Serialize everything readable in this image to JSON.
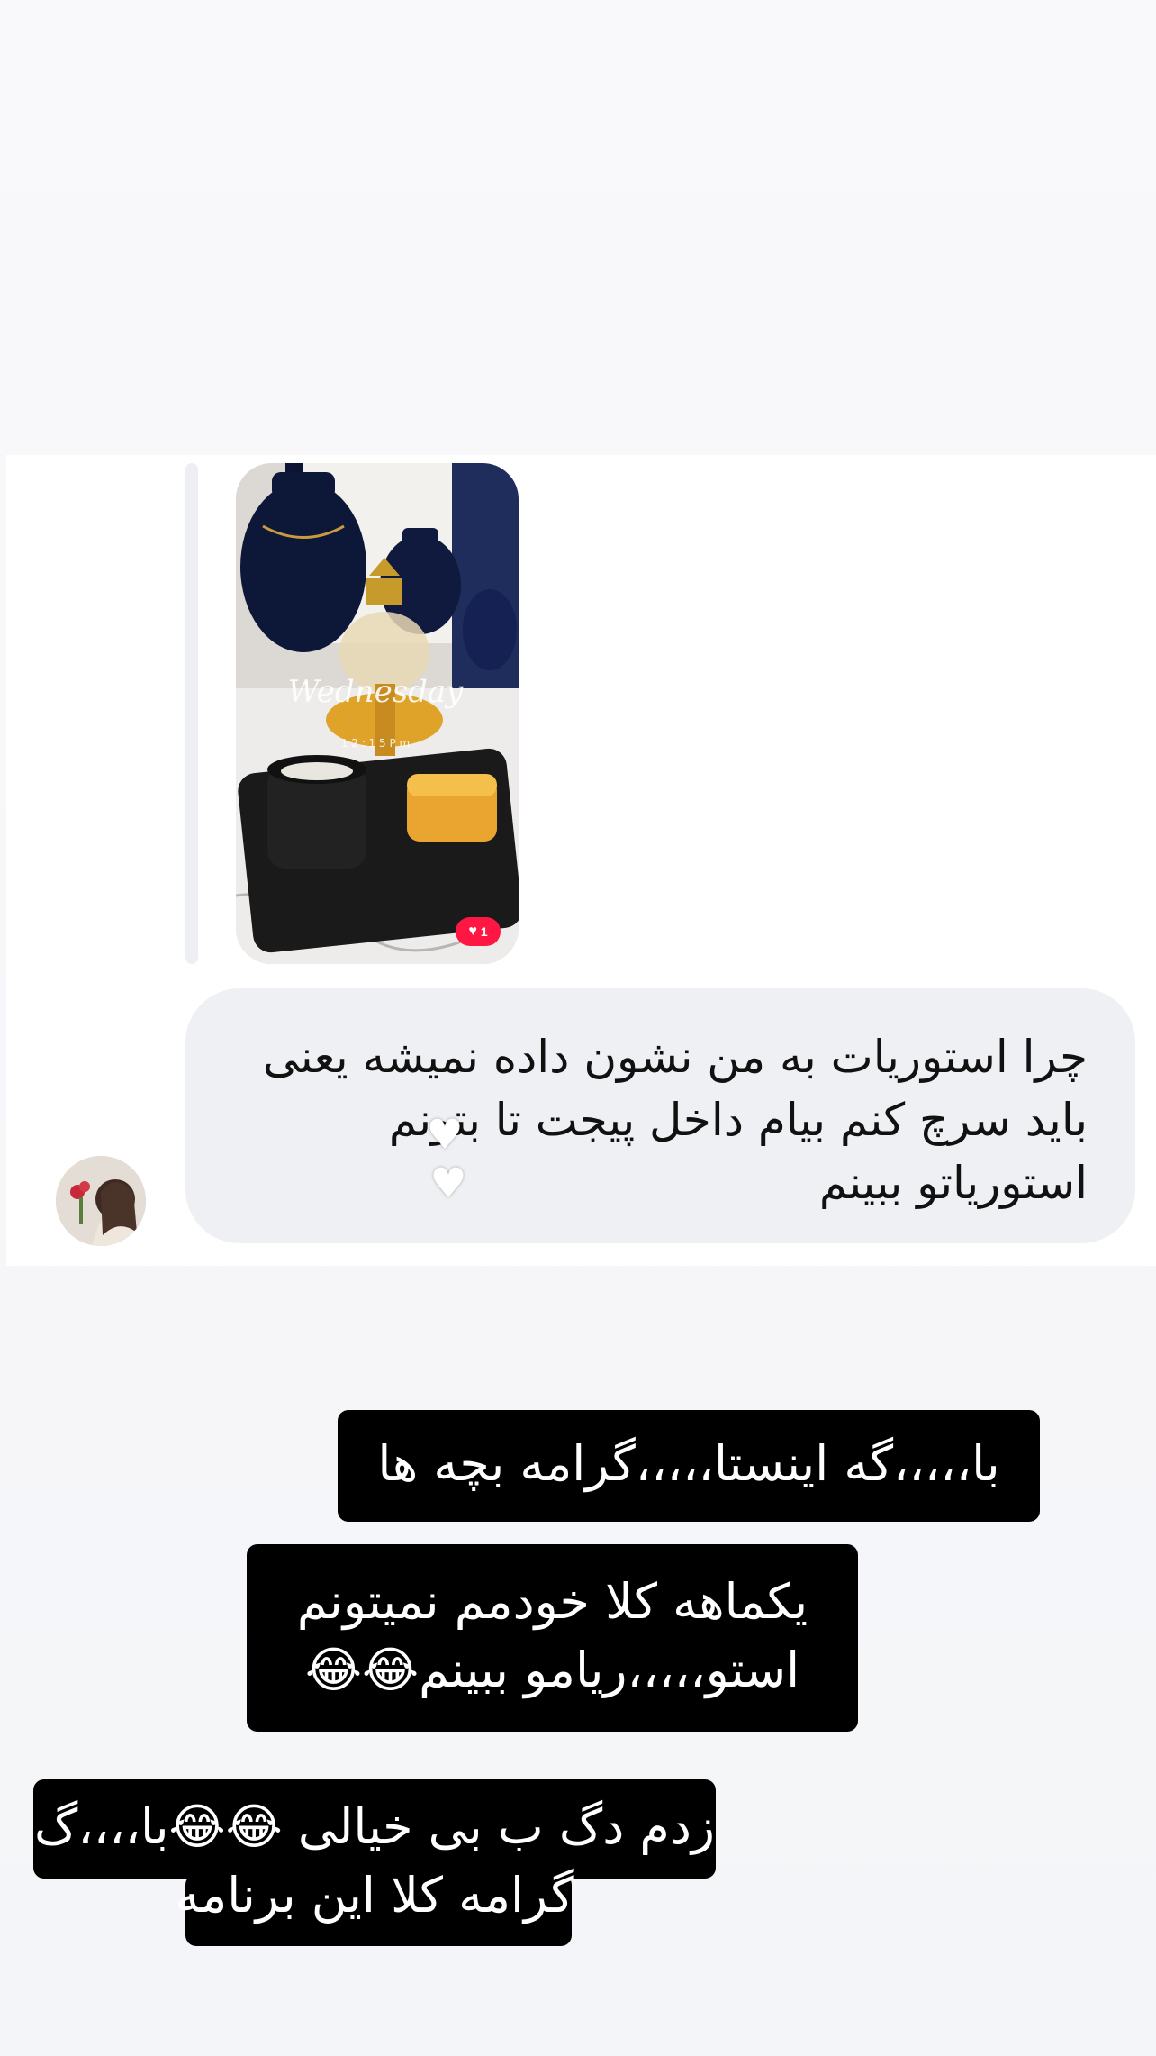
{
  "story_reply": {
    "like_count": "1",
    "thumbnail_overlay_text": "Wednesday",
    "thumbnail_time": "1 2 : 1 5  P m"
  },
  "message": {
    "line1": "چرا استوریات به من نشون داده نمیشه یعنی",
    "line2": "باید سرچ کنم بیام داخل پیجت تا بتونم",
    "line3": "استوریاتو ببینم",
    "reaction_icon": "white-heart-icon"
  },
  "captions": [
    {
      "text": "با،،،،،گه اینستا،،،،،گرامه بچه ها"
    },
    {
      "line1": "یکماهه کلا خودمم نمیتونم",
      "line2": "استو،،،،،ریامو ببینم😂😂"
    },
    {
      "line1": "زدم دگ ب بی خیالی 😂😂با،،،،گ",
      "line2": "گرامه کلا این برنامه"
    }
  ],
  "colors": {
    "bubble": "#eff0f3",
    "caption_bg": "#000000",
    "like_badge": "#ff1744"
  }
}
